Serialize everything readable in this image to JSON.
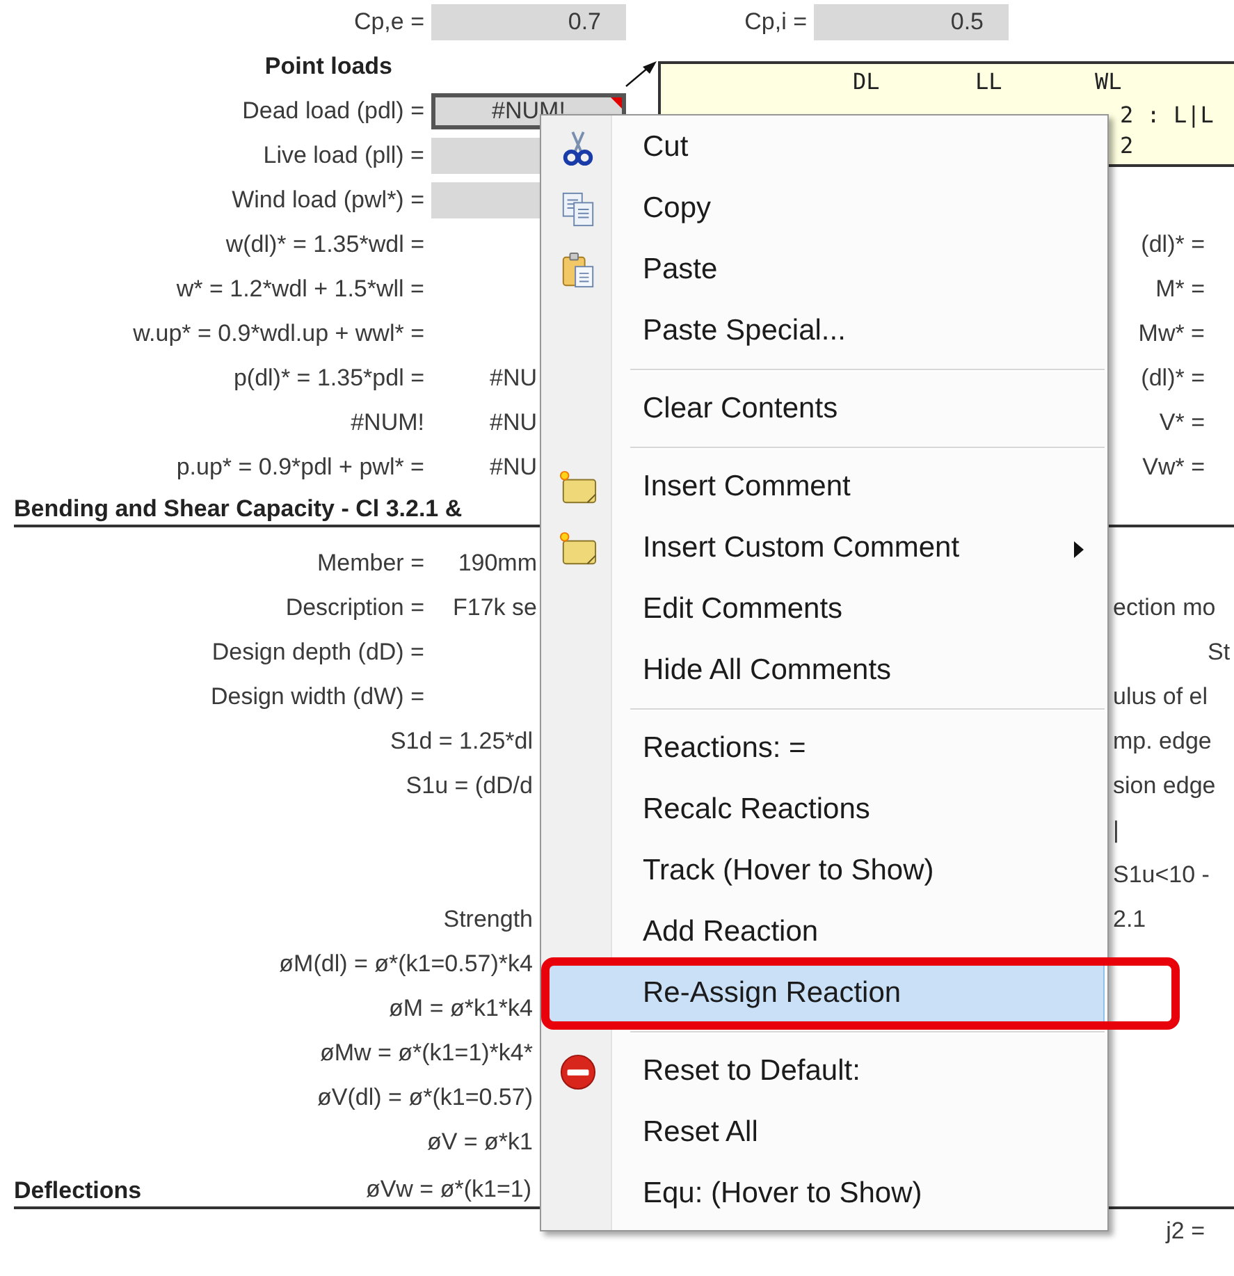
{
  "rows": [
    {
      "kind": "field",
      "label": "Cp,e =",
      "cell": {
        "kind": "input",
        "value": "0.7"
      },
      "mid_label": "Cp,i =",
      "mid_cell": {
        "kind": "input",
        "value": "0.5"
      }
    },
    {
      "kind": "subheading",
      "label": "Point loads"
    },
    {
      "kind": "field",
      "label": "Dead load (pdl) =",
      "cell": {
        "kind": "active",
        "value": "#NUM!"
      }
    },
    {
      "kind": "field",
      "label": "Live load (pll) =",
      "cell": {
        "kind": "input_partial"
      }
    },
    {
      "kind": "field",
      "label": "Wind load (pwl*) =",
      "cell": {
        "kind": "input_partial"
      }
    },
    {
      "kind": "field",
      "label": "w(dl)* = 1.35*wdl =",
      "right": {
        "kind": "eq",
        "text": "(dl)* ="
      }
    },
    {
      "kind": "field",
      "label": "w* = 1.2*wdl + 1.5*wll =",
      "right": {
        "kind": "eq",
        "text": "M* ="
      }
    },
    {
      "kind": "field",
      "label": "w.up* = 0.9*wdl.up + wwl* =",
      "right": {
        "kind": "eq",
        "text": "Mw* ="
      }
    },
    {
      "kind": "field",
      "label": "p(dl)* = 1.35*pdl =",
      "value": "#NU",
      "right": {
        "kind": "eq",
        "text": "(dl)* ="
      }
    },
    {
      "kind": "field",
      "label": "#NUM!",
      "value": "#NU",
      "right": {
        "kind": "eq",
        "text": "V* ="
      }
    },
    {
      "kind": "field",
      "label": "p.up* = 0.9*pdl + pwl* =",
      "value": "#NU",
      "right": {
        "kind": "eq",
        "text": "Vw* ="
      }
    },
    {
      "kind": "heading",
      "heading": "Bending and Shear Capacity - Cl 3.2.1 &"
    },
    {
      "kind": "field",
      "label": "Member =",
      "value": "190mm"
    },
    {
      "kind": "field",
      "label": "Description =",
      "value": "F17k se",
      "right": {
        "kind": "edge",
        "text": "ection mo"
      }
    },
    {
      "kind": "field",
      "label": "Design depth (dD) =",
      "right": {
        "kind": "far",
        "text": "St"
      }
    },
    {
      "kind": "field",
      "label": "Design width (dW) =",
      "right": {
        "kind": "edge",
        "text": "ulus of el"
      }
    },
    {
      "kind": "cut",
      "label": "S1d = 1.25*dl",
      "right": {
        "kind": "edge",
        "text": "mp. edge"
      }
    },
    {
      "kind": "cut",
      "label": "S1u = (dD/d",
      "right": {
        "kind": "edge",
        "text": "sion edge"
      }
    },
    {
      "kind": "field",
      "right": {
        "kind": "edge",
        "text": "|"
      }
    },
    {
      "kind": "field",
      "right": {
        "kind": "edge",
        "text": "S1u<10 -"
      }
    },
    {
      "kind": "cut",
      "label": "Strength",
      "right": {
        "kind": "edge",
        "text": "2.1"
      }
    },
    {
      "kind": "cut",
      "label": "øM(dl) = ø*(k1=0.57)*k4"
    },
    {
      "kind": "cut",
      "label": "øM = ø*k1*k4"
    },
    {
      "kind": "cut",
      "label": "øMw = ø*(k1=1)*k4*"
    },
    {
      "kind": "cut",
      "label": "øV(dl) = ø*(k1=0.57)"
    },
    {
      "kind": "cut",
      "label": "øV = ø*k1"
    },
    {
      "kind": "heading",
      "heading": "Deflections",
      "label": "øVw = ø*(k1=1)"
    },
    {
      "kind": "field",
      "right": {
        "kind": "eq",
        "text": "j2 ="
      }
    }
  ],
  "comment": {
    "columns": [
      "DL",
      "LL",
      "WL"
    ],
    "lines": [
      "2 : L|L",
      "2"
    ]
  },
  "menu": [
    {
      "kind": "scissors",
      "label": "Cut",
      "selected": false
    },
    {
      "kind": "pages",
      "label": "Copy",
      "selected": false
    },
    {
      "kind": "clipboard",
      "label": "Paste",
      "selected": false
    },
    {
      "kind": "plain",
      "label": "Paste Special...",
      "selected": false
    },
    {
      "kind": "separator"
    },
    {
      "kind": "plain",
      "label": "Clear Contents",
      "selected": false
    },
    {
      "kind": "separator"
    },
    {
      "kind": "note",
      "label": "Insert Comment",
      "selected": false
    },
    {
      "kind": "note",
      "label": "Insert Custom Comment",
      "selected": false,
      "submenu": true
    },
    {
      "kind": "plain",
      "label": "Edit Comments",
      "selected": false
    },
    {
      "kind": "plain",
      "label": "Hide All Comments",
      "selected": false
    },
    {
      "kind": "separator"
    },
    {
      "kind": "plain",
      "label": "Reactions: =",
      "selected": false
    },
    {
      "kind": "plain",
      "label": "Recalc Reactions",
      "selected": false
    },
    {
      "kind": "plain",
      "label": "Track (Hover to Show)",
      "selected": false
    },
    {
      "kind": "plain",
      "label": "Add Reaction",
      "selected": false
    },
    {
      "kind": "plain",
      "label": "Re-Assign Reaction",
      "selected": true,
      "annotated": true
    },
    {
      "kind": "separator"
    },
    {
      "kind": "stop",
      "label": "Reset to Default:",
      "selected": false
    },
    {
      "kind": "plain",
      "label": "Reset All",
      "selected": false
    },
    {
      "kind": "plain",
      "label": "Equ:  (Hover to Show)",
      "selected": false
    }
  ]
}
